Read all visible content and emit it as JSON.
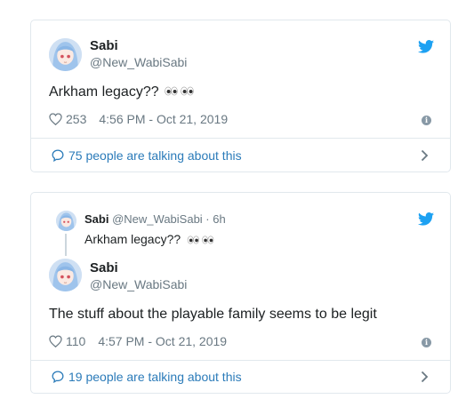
{
  "tweets": [
    {
      "author": {
        "name": "Sabi",
        "handle": "@New_WabiSabi"
      },
      "text": "Arkham legacy??",
      "emoji": "eyes",
      "likes": "253",
      "timestamp": "4:56 PM - Oct 21, 2019",
      "talking": "75 people are talking about this"
    },
    {
      "quoted": {
        "name": "Sabi",
        "handle_time": "@New_WabiSabi · 6h",
        "text": "Arkham legacy??",
        "emoji": "eyes"
      },
      "author": {
        "name": "Sabi",
        "handle": "@New_WabiSabi"
      },
      "text": "The stuff about the playable family seems to be legit",
      "likes": "110",
      "timestamp": "4:57 PM - Oct 21, 2019",
      "talking": "19 people are talking about this"
    }
  ],
  "icons": {
    "brand": "twitter-bird-icon",
    "like": "heart-icon",
    "info": "info-icon",
    "reply": "speech-bubble-icon",
    "chevron": "chevron-right-icon"
  },
  "colors": {
    "brand_blue": "#1da1f2",
    "link_blue": "#2b7bb9",
    "muted_gray": "#697882",
    "border": "#e1e8ed"
  }
}
